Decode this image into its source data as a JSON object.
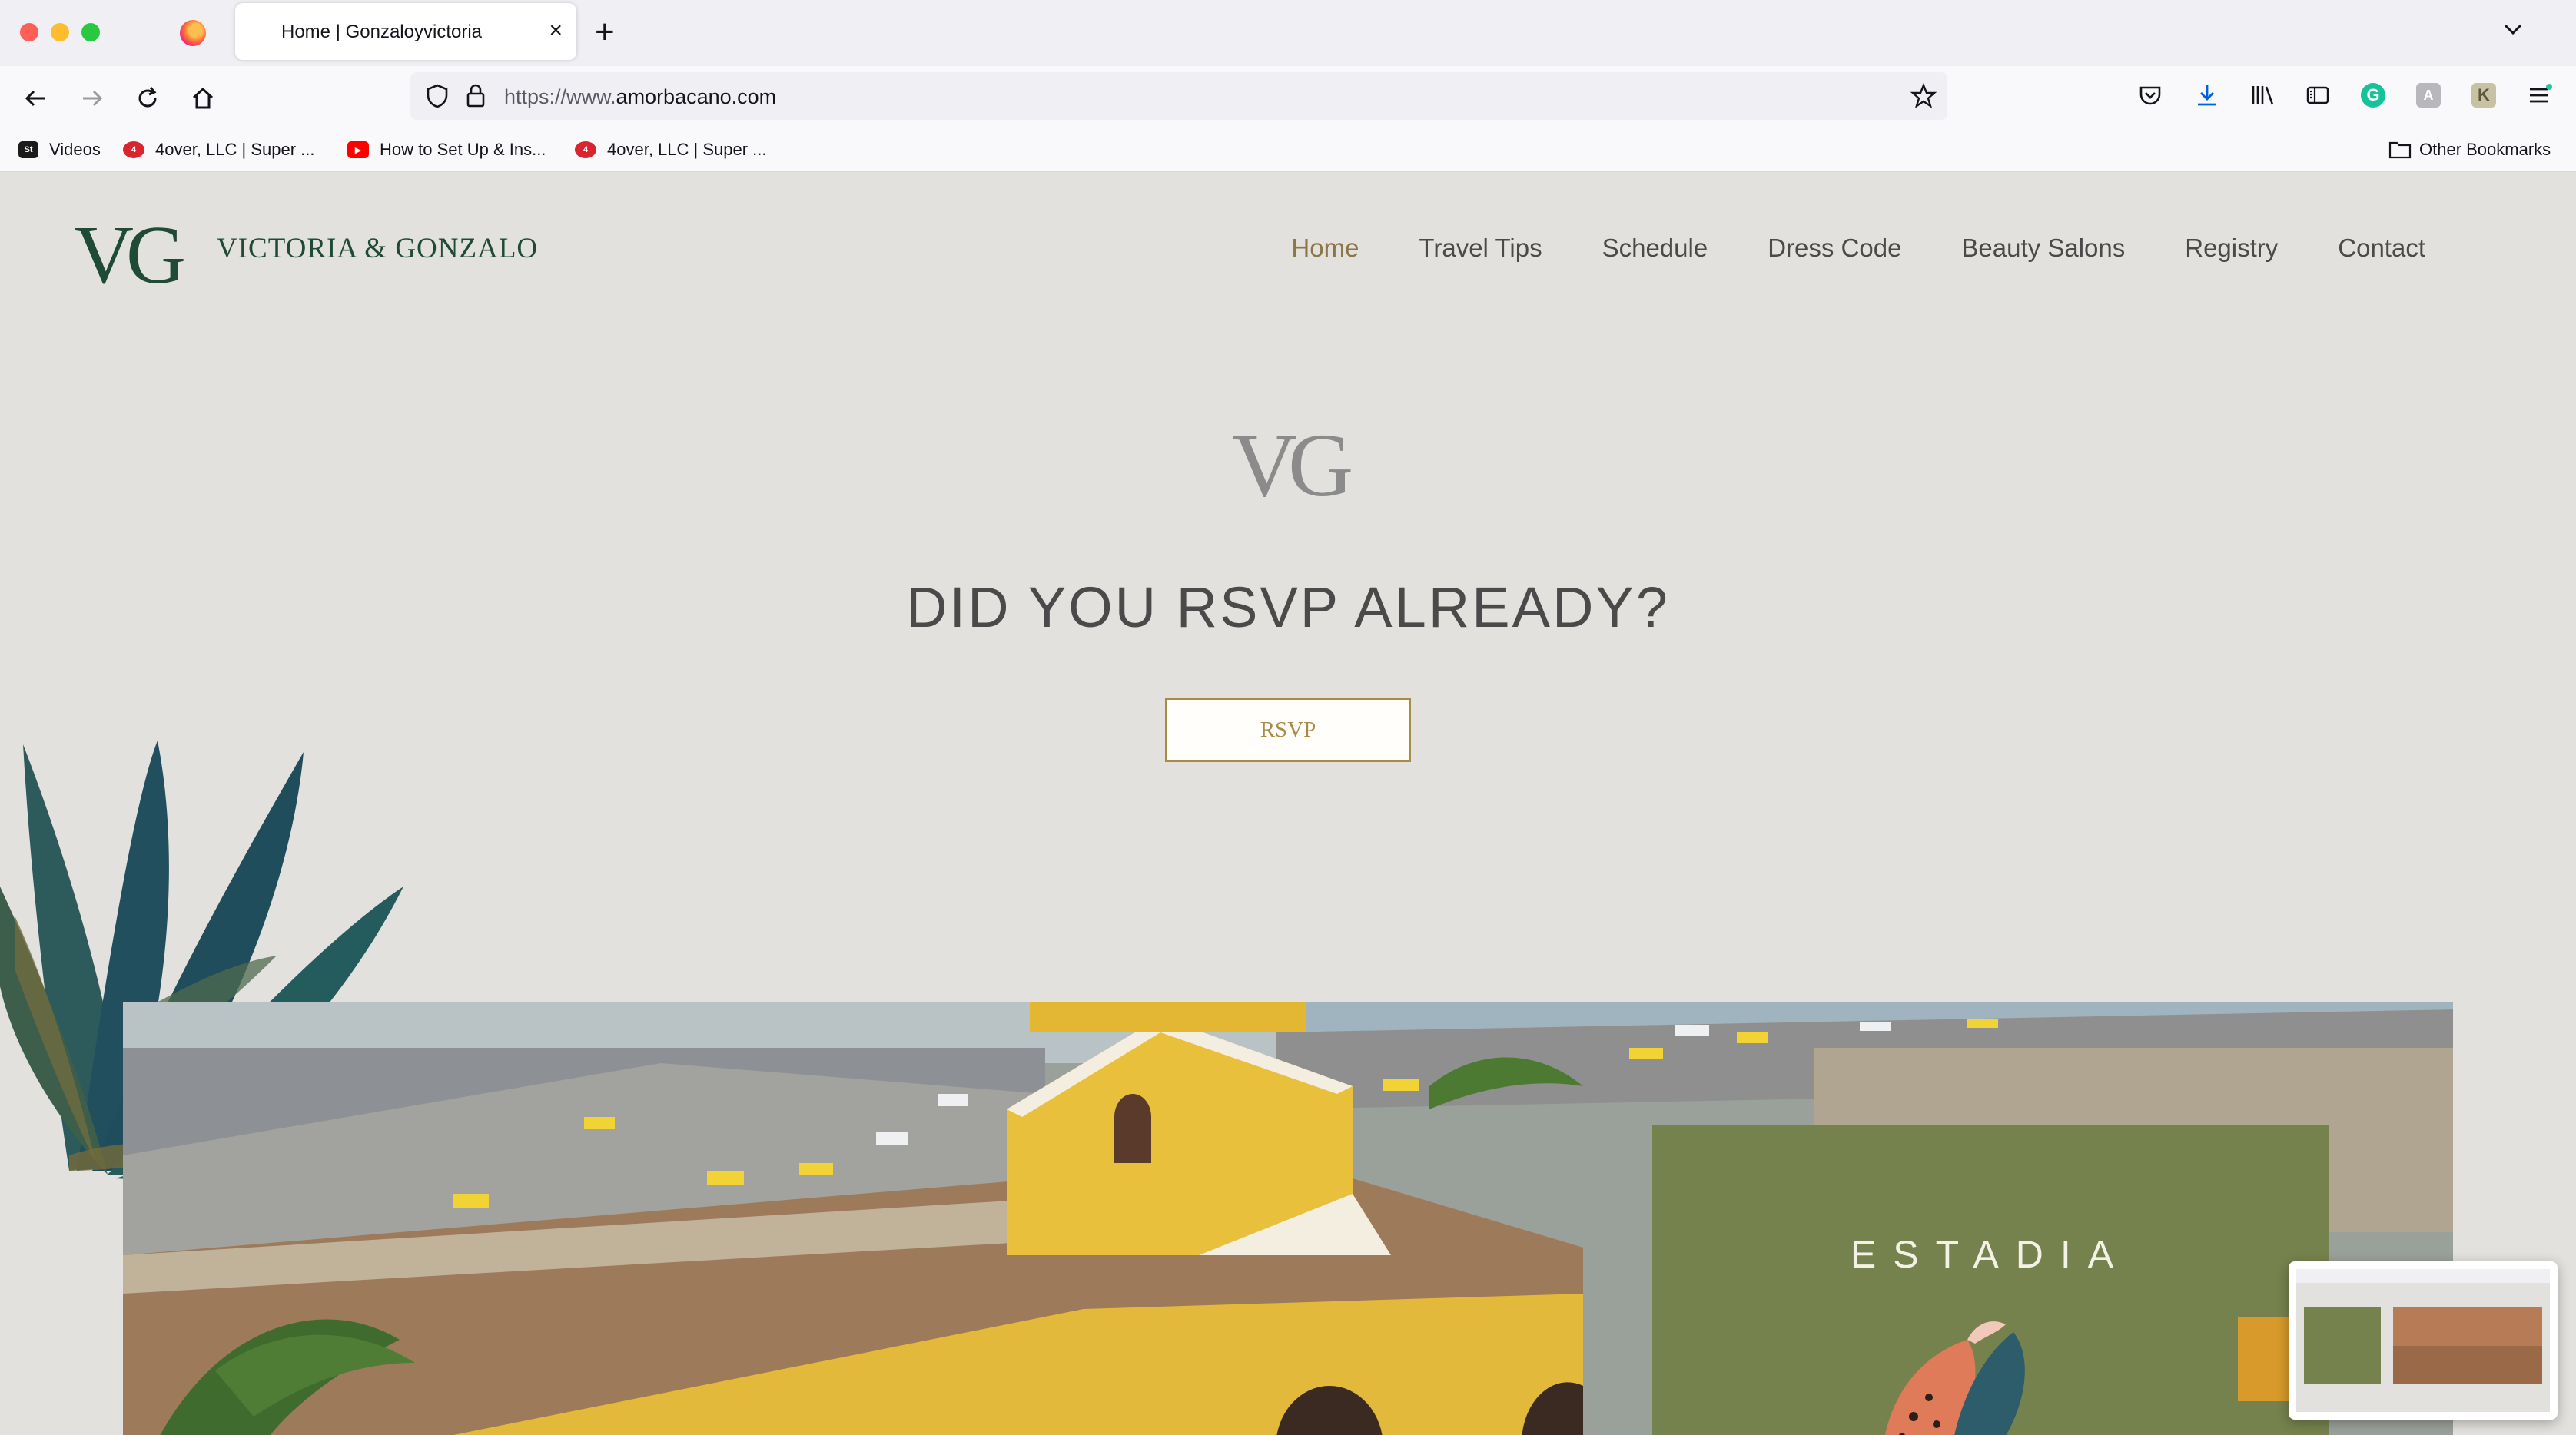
{
  "browser": {
    "tab_title": "Home | Gonzaloyvictoria",
    "url_protocol": "https://www.",
    "url_domain": "amorbacano.com",
    "bookmarks": [
      {
        "label": "Videos",
        "icon": "streamable-icon"
      },
      {
        "label": "4over, LLC | Super ...",
        "icon": "4over-icon"
      },
      {
        "label": "How to Set Up & Ins...",
        "icon": "youtube-icon"
      },
      {
        "label": "4over, LLC | Super ...",
        "icon": "4over-icon"
      }
    ],
    "other_bookmarks": "Other Bookmarks"
  },
  "site": {
    "logo_mark": "VG",
    "name": "VICTORIA & GONZALO",
    "nav": [
      {
        "label": "Home",
        "active": true
      },
      {
        "label": "Travel Tips"
      },
      {
        "label": "Schedule"
      },
      {
        "label": "Dress Code"
      },
      {
        "label": "Beauty Salons"
      },
      {
        "label": "Registry"
      },
      {
        "label": "Contact"
      }
    ],
    "hero_mark": "VG",
    "rsvp_heading": "DID YOU RSVP ALREADY?",
    "rsvp_button": "RSVP",
    "estadia_title": "ESTADIA"
  },
  "colors": {
    "page_bg": "#e2e1dd",
    "brand_green": "#1f4a35",
    "accent_gold": "#a88b46",
    "nav_active": "#8c7546",
    "olive_card": "#76824d"
  }
}
